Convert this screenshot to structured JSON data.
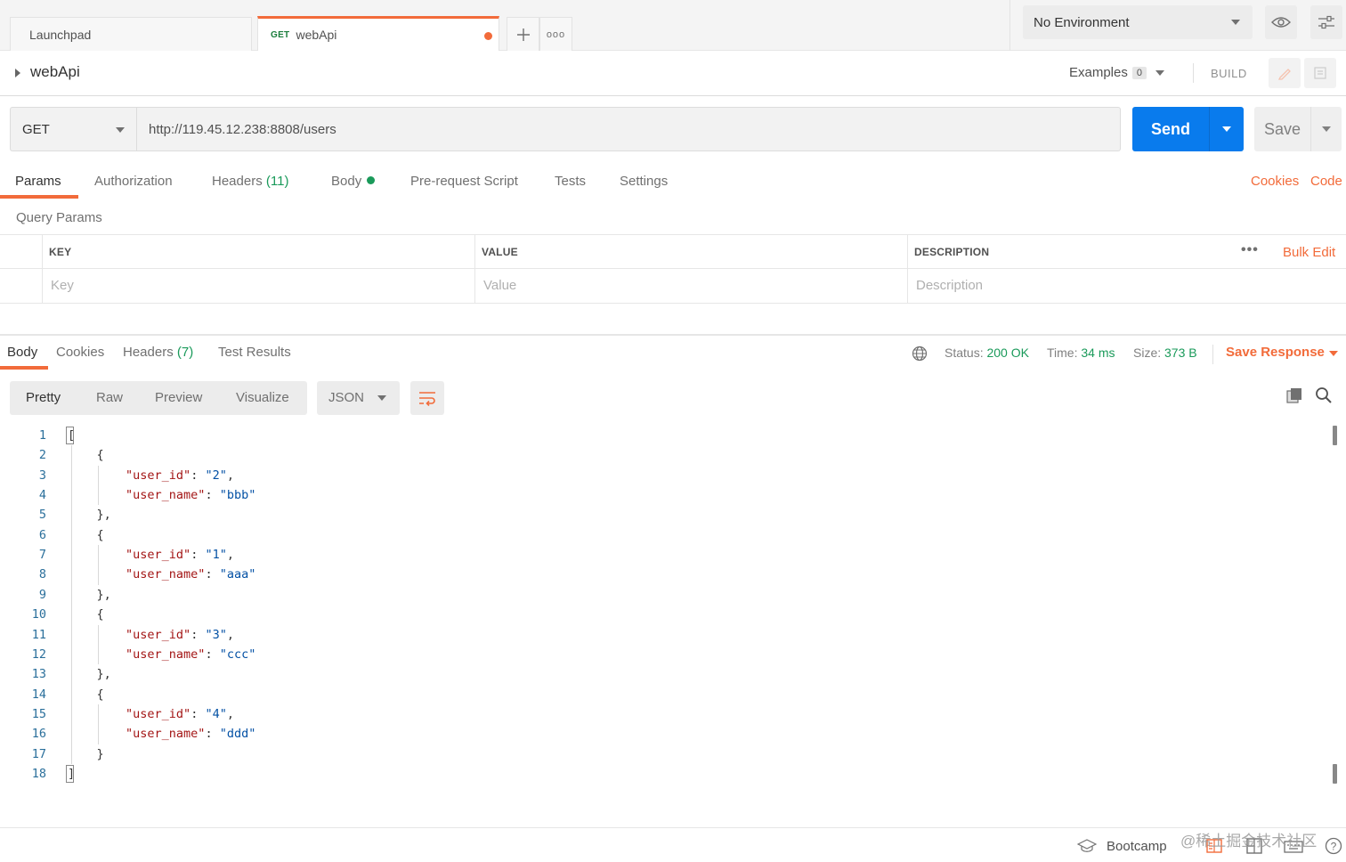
{
  "tabs": {
    "launchpad": "Launchpad",
    "active_method": "GET",
    "active_name": "webApi",
    "more": "ooo"
  },
  "environment": {
    "selected": "No Environment"
  },
  "request": {
    "name": "webApi",
    "examples_label": "Examples",
    "examples_count": "0",
    "build_label": "BUILD",
    "method": "GET",
    "url": "http://119.45.12.238:8808/users",
    "send_label": "Send",
    "save_label": "Save"
  },
  "request_tabs": {
    "params": "Params",
    "authorization": "Authorization",
    "headers": "Headers",
    "headers_count": "(11)",
    "body": "Body",
    "pre_request": "Pre-request Script",
    "tests": "Tests",
    "settings": "Settings",
    "cookies": "Cookies",
    "code": "Code"
  },
  "query_params": {
    "title": "Query Params",
    "columns": {
      "key": "KEY",
      "value": "VALUE",
      "description": "DESCRIPTION"
    },
    "placeholders": {
      "key": "Key",
      "value": "Value",
      "description": "Description"
    },
    "more": "•••",
    "bulk_edit": "Bulk Edit"
  },
  "response": {
    "tabs": {
      "body": "Body",
      "cookies": "Cookies",
      "headers": "Headers",
      "headers_count": "(7)",
      "test_results": "Test Results"
    },
    "status_label": "Status:",
    "status_value": "200 OK",
    "time_label": "Time:",
    "time_value": "34 ms",
    "size_label": "Size:",
    "size_value": "373 B",
    "save_response": "Save Response",
    "views": {
      "pretty": "Pretty",
      "raw": "Raw",
      "preview": "Preview",
      "visualize": "Visualize"
    },
    "format": "JSON",
    "users": [
      {
        "user_id": "2",
        "user_name": "bbb"
      },
      {
        "user_id": "1",
        "user_name": "aaa"
      },
      {
        "user_id": "3",
        "user_name": "ccc"
      },
      {
        "user_id": "4",
        "user_name": "ddd"
      }
    ]
  },
  "footer": {
    "bootcamp": "Bootcamp",
    "watermark": "@稀土掘金技术社区"
  },
  "colors": {
    "accent": "#f26b3a",
    "send": "#097bed",
    "success": "#1a9a5a",
    "json_key": "#a31515",
    "json_string": "#0451a5"
  }
}
